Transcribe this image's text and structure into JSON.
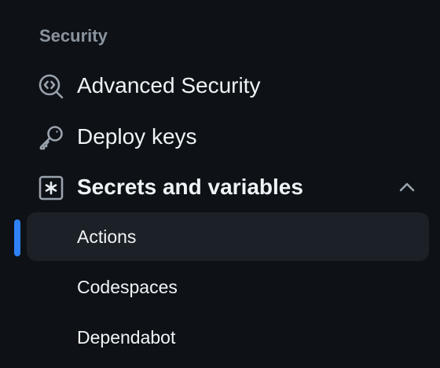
{
  "sidebar": {
    "section_title": "Security",
    "items": [
      {
        "label": "Advanced Security",
        "icon": "codescan-icon"
      },
      {
        "label": "Deploy keys",
        "icon": "key-icon"
      },
      {
        "label": "Secrets and variables",
        "icon": "asterisk-box-icon",
        "expanded": true
      }
    ],
    "sub_items": [
      {
        "label": "Actions",
        "active": true
      },
      {
        "label": "Codespaces",
        "active": false
      },
      {
        "label": "Dependabot",
        "active": false
      }
    ],
    "colors": {
      "background": "#0e1116",
      "text": "#f0f3f6",
      "muted": "#8b949e",
      "active_bg": "#1c2128",
      "accent": "#2f81f7"
    }
  }
}
